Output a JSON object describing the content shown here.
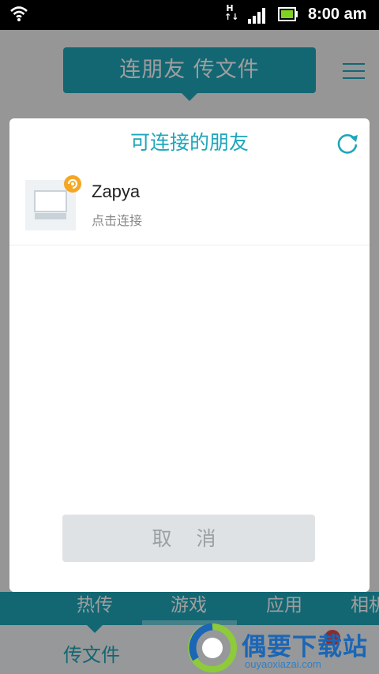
{
  "status_bar": {
    "network_type": "H",
    "time": "8:00 am"
  },
  "header": {
    "title": "连朋友 传文件"
  },
  "dialog": {
    "title": "可连接的朋友",
    "friends": [
      {
        "name": "Zapya",
        "action": "点击连接"
      }
    ],
    "cancel_label": "取 消"
  },
  "tabs": [
    "热传",
    "游戏",
    "应用",
    "相机"
  ],
  "active_tab": 1,
  "bottom_nav": {
    "send_label": "传文件"
  },
  "watermark": {
    "title": "偶要下载站",
    "url": "ouyaoxiazai.com"
  },
  "colors": {
    "accent": "#1ea6ba",
    "badge": "#e2474a",
    "online": "#f5a623"
  }
}
